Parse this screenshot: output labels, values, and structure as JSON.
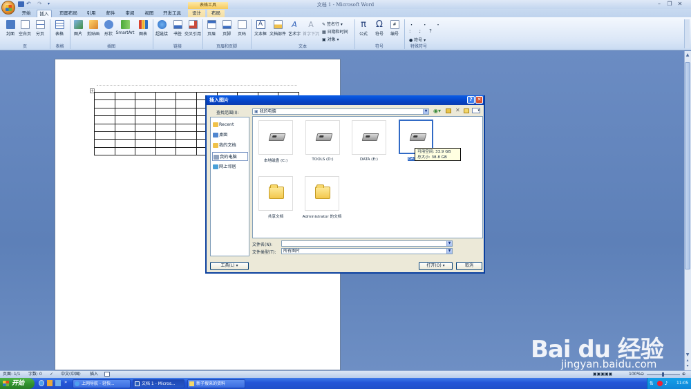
{
  "window": {
    "title": "文档 1 - Microsoft Word",
    "contextual_tab_group": "表格工具"
  },
  "tabs": [
    "开始",
    "插入",
    "页面布局",
    "引用",
    "邮件",
    "审阅",
    "视图",
    "开发工具",
    "设计",
    "布局"
  ],
  "active_tab": "插入",
  "ribbon": {
    "groups": [
      {
        "label": "页",
        "buttons": [
          "封面",
          "空白页",
          "分页"
        ]
      },
      {
        "label": "表格",
        "buttons": [
          "表格"
        ]
      },
      {
        "label": "插图",
        "buttons": [
          "图片",
          "剪贴画",
          "形状",
          "SmartArt",
          "图表"
        ]
      },
      {
        "label": "链接",
        "buttons": [
          "超链接",
          "书签",
          "交叉引用"
        ]
      },
      {
        "label": "页眉和页脚",
        "buttons": [
          "页眉",
          "页脚",
          "页码"
        ]
      },
      {
        "label": "文本",
        "buttons": [
          "文本框",
          "文档部件",
          "艺术字",
          "首字下沉"
        ],
        "small_items": [
          "签名行",
          "日期和时间",
          "对象"
        ]
      },
      {
        "label": "符号",
        "buttons": [
          "公式",
          "符号",
          "编号"
        ]
      },
      {
        "label": "特殊符号",
        "buttons": [
          "符号"
        ]
      }
    ],
    "accent": "#dbe7f7"
  },
  "dialog": {
    "title": "插入图片",
    "lookin_label": "查找范围(I):",
    "lookin_value": "我的电脑",
    "places": [
      "Recent",
      "桌面",
      "我的文档",
      "我的电脑",
      "网上邻居"
    ],
    "selected_place": "我的电脑",
    "items": [
      {
        "label": "本地磁盘 (C:)",
        "type": "drive"
      },
      {
        "label": "TOOLS (D:)",
        "type": "drive"
      },
      {
        "label": "DATA (E:)",
        "type": "drive"
      },
      {
        "label": "BACKUP",
        "type": "drive"
      },
      {
        "label": "共享文档",
        "type": "folder"
      },
      {
        "label": "Administrator 的文档",
        "type": "folder"
      }
    ],
    "tooltip": {
      "line1": "可用空间: 33.9 GB",
      "line2": "总大小: 38.8 GB"
    },
    "filename_label": "文件名(N):",
    "filename_value": "",
    "filetype_label": "文件类型(T):",
    "filetype_value": "所有图片",
    "tools_button": "工具(L)",
    "open_button": "打开(O)",
    "cancel_button": "取消"
  },
  "statusbar": {
    "page": "页面: 1/1",
    "words": "字数: 0",
    "language": "中文(中国)",
    "mode": "插入",
    "zoom": "100%"
  },
  "taskbar": {
    "start": "开始",
    "tasks": [
      "上网导航 - 轻快...",
      "文档 1 - Micros...",
      "新子搜来的资料"
    ],
    "clock": "11:05"
  },
  "watermark": {
    "logo": "Bai du 经验",
    "url": "jingyan.baidu.com"
  }
}
